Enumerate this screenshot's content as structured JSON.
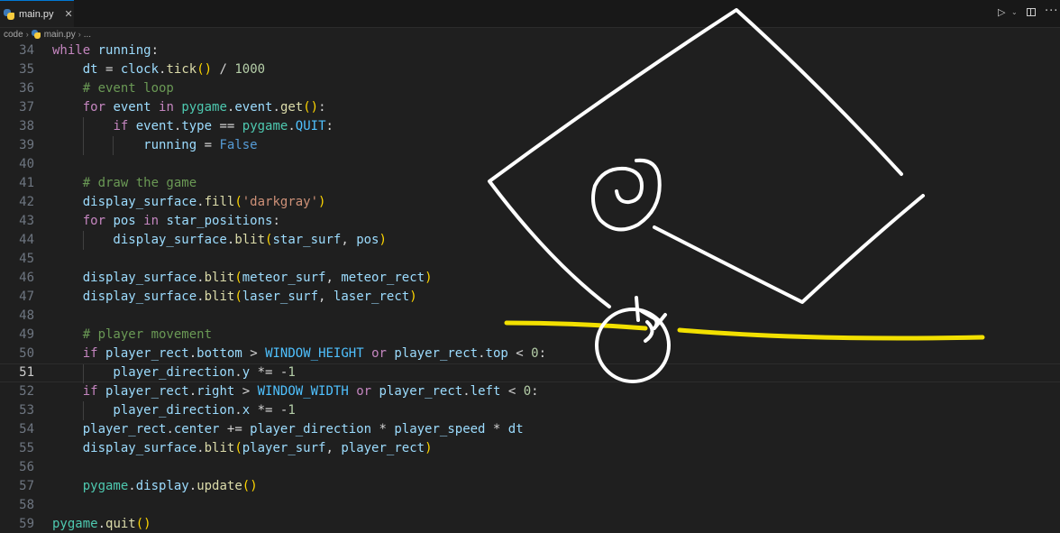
{
  "tab": {
    "filename": "main.py",
    "close_glyph": "✕"
  },
  "breadcrumb": {
    "folder": "code",
    "file": "main.py",
    "trail": "..."
  },
  "toolbar": {
    "run_icon": "play-icon",
    "split_icon": "split-editor-icon",
    "more_icon": "more-actions-icon"
  },
  "editor": {
    "current_line": 51,
    "colors": {
      "keyword": "#c586c0",
      "comment": "#6a9955",
      "function": "#dcdcaa",
      "class": "#4ec9b0",
      "number": "#b5cea8",
      "string": "#ce9178",
      "constant": "#4fc1ff",
      "boolean": "#569cd6"
    },
    "lines": [
      {
        "n": "34",
        "text": "while running:"
      },
      {
        "n": "35",
        "text": "    dt = clock.tick() / 1000"
      },
      {
        "n": "36",
        "text": "    # event loop"
      },
      {
        "n": "37",
        "text": "    for event in pygame.event.get():"
      },
      {
        "n": "38",
        "text": "        if event.type == pygame.QUIT:"
      },
      {
        "n": "39",
        "text": "            running = False"
      },
      {
        "n": "40",
        "text": ""
      },
      {
        "n": "41",
        "text": "    # draw the game"
      },
      {
        "n": "42",
        "text": "    display_surface.fill('darkgray')"
      },
      {
        "n": "43",
        "text": "    for pos in star_positions:"
      },
      {
        "n": "44",
        "text": "        display_surface.blit(star_surf, pos)"
      },
      {
        "n": "45",
        "text": ""
      },
      {
        "n": "46",
        "text": "    display_surface.blit(meteor_surf, meteor_rect)"
      },
      {
        "n": "47",
        "text": "    display_surface.blit(laser_surf, laser_rect)"
      },
      {
        "n": "48",
        "text": ""
      },
      {
        "n": "49",
        "text": "    # player movement"
      },
      {
        "n": "50",
        "text": "    if player_rect.bottom > WINDOW_HEIGHT or player_rect.top < 0:"
      },
      {
        "n": "51",
        "text": "        player_direction.y *= -1"
      },
      {
        "n": "52",
        "text": "    if player_rect.right > WINDOW_WIDTH or player_rect.left < 0:"
      },
      {
        "n": "53",
        "text": "        player_direction.x *= -1"
      },
      {
        "n": "54",
        "text": "    player_rect.center += player_direction * player_speed * dt"
      },
      {
        "n": "55",
        "text": "    display_surface.blit(player_surf, player_rect)"
      },
      {
        "n": "56",
        "text": ""
      },
      {
        "n": "57",
        "text": "    pygame.display.update()"
      },
      {
        "n": "58",
        "text": ""
      },
      {
        "n": "59",
        "text": "pygame.quit()"
      }
    ]
  },
  "sketch": {
    "ink_color": "#ffffff",
    "highlight_color": "#f2e000"
  }
}
